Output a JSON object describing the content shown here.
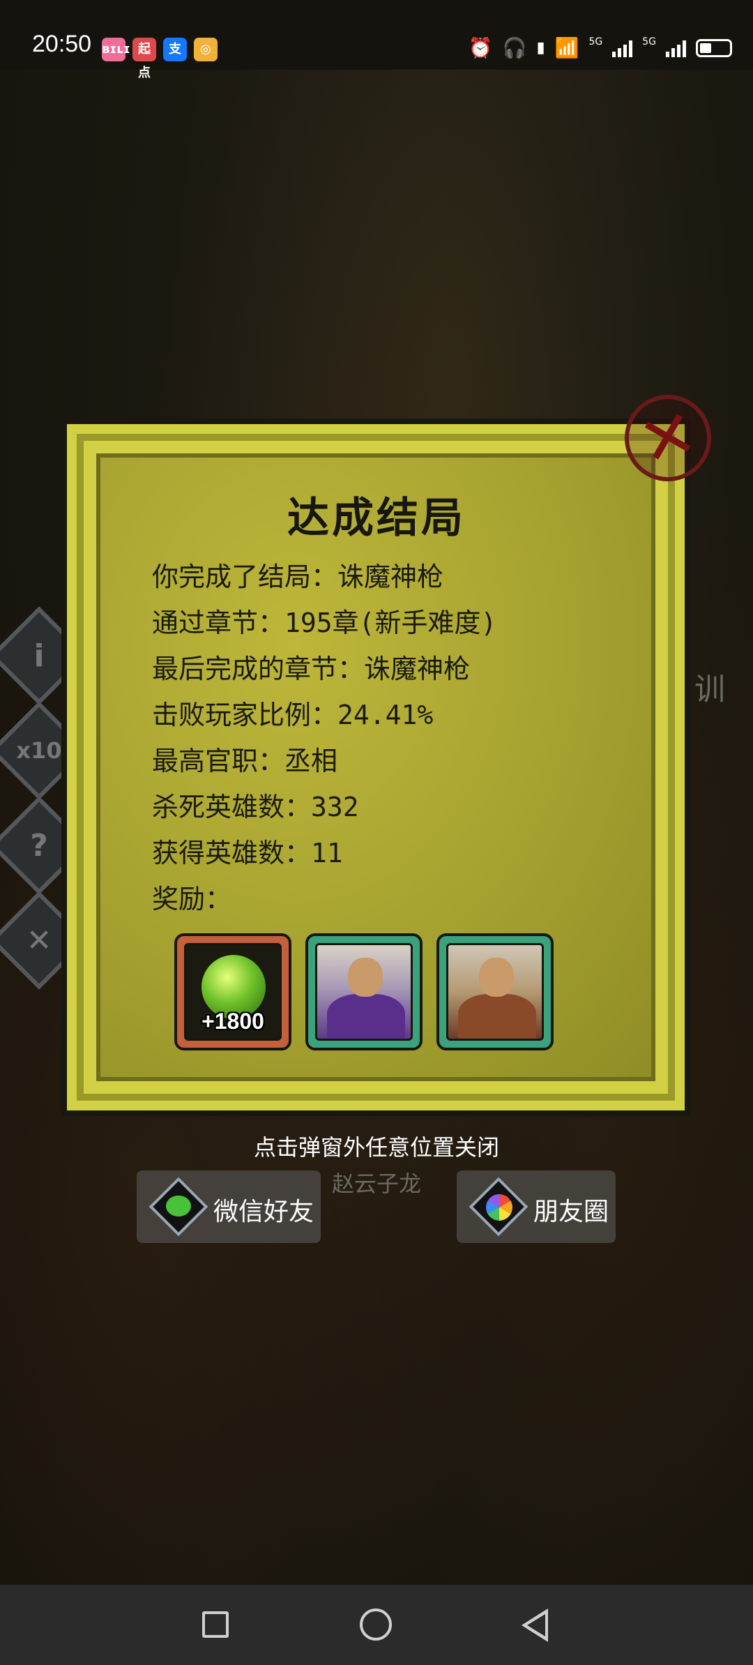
{
  "status_bar": {
    "time": "20:50",
    "apps": [
      {
        "icon": "bilibili-icon",
        "label": "ʙɪʟɪ",
        "color": "#f06d9a"
      },
      {
        "icon": "qidian-icon",
        "label": "起点",
        "color": "#e0484b"
      },
      {
        "icon": "alipay-icon",
        "label": "支",
        "color": "#1677ff"
      },
      {
        "icon": "app-icon",
        "label": "◎",
        "color": "#f0b23a"
      }
    ],
    "signal_1": "5G",
    "signal_2": "5G"
  },
  "side_buttons": {
    "info": "i",
    "speed": "x10",
    "help": "?",
    "exit": "✕"
  },
  "background_text": {
    "right_fragment": "训",
    "hero_name": "赵云子龙"
  },
  "modal": {
    "title": "达成结局",
    "lines": [
      "你完成了结局：诛魔神枪",
      "通过章节：195章(新手难度)",
      "最后完成的章节：诛魔神枪",
      "击败玩家比例：24.41%",
      "最高官职：丞相",
      "杀死英雄数：332",
      "获得英雄数：11",
      "奖励："
    ],
    "rewards": [
      {
        "type": "gem",
        "count": "+1800"
      },
      {
        "type": "hero-portrait",
        "count": ""
      },
      {
        "type": "hero-portrait",
        "count": ""
      }
    ]
  },
  "hint": "点击弹窗外任意位置关闭",
  "share": {
    "wechat_label": "微信好友",
    "moments_label": "朋友圈"
  }
}
